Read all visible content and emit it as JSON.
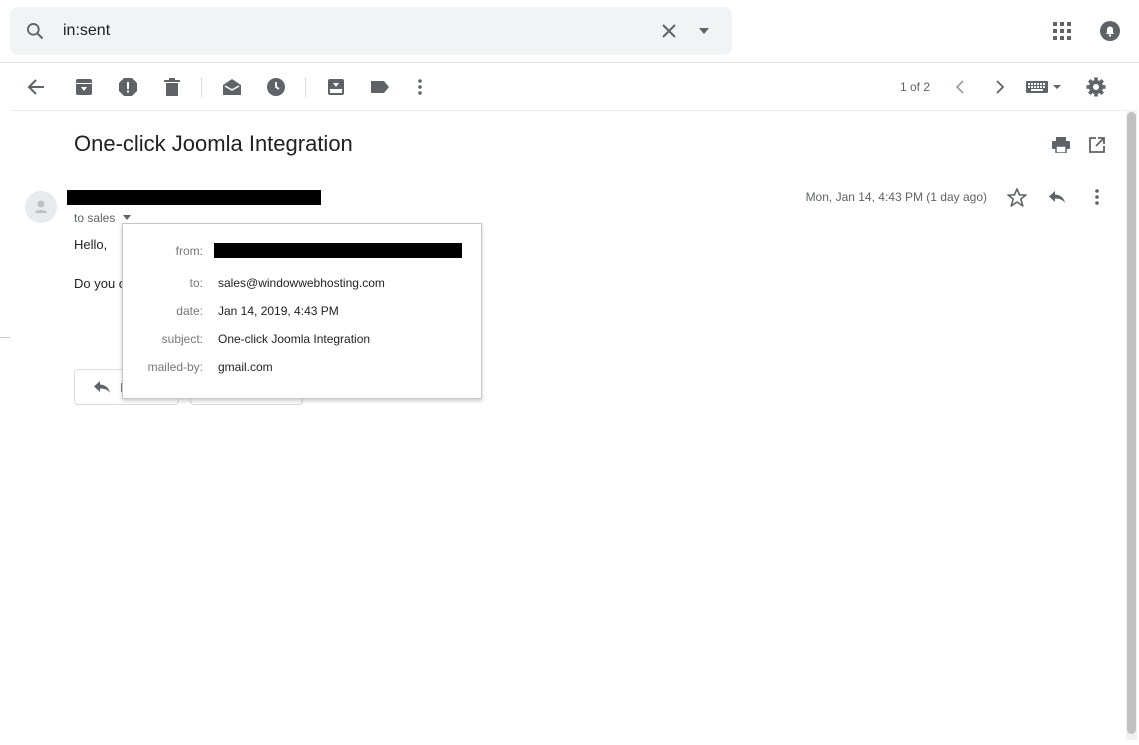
{
  "search": {
    "query": "in:sent"
  },
  "toolbar": {
    "page_count": "1 of 2"
  },
  "message": {
    "subject": "One-click Joomla Integration",
    "to_line": "to sales",
    "date_line": "Mon, Jan 14, 4:43 PM (1 day ago)",
    "greeting": "Hello,",
    "body_partial": "Do you c"
  },
  "details": {
    "from_label": "from:",
    "to_label": "to:",
    "to_value": "sales@windowwebhosting.com",
    "date_label": "date:",
    "date_value": "Jan 14, 2019, 4:43 PM",
    "subject_label": "subject:",
    "subject_value": "One-click Joomla Integration",
    "mailed_by_label": "mailed-by:",
    "mailed_by_value": "gmail.com"
  },
  "reply_button": {
    "partial_label": "I"
  },
  "icons": [
    "search-icon",
    "clear-icon",
    "search-options-icon",
    "apps-icon",
    "notifications-icon",
    "back-icon",
    "archive-icon",
    "report-spam-icon",
    "delete-icon",
    "mark-unread-icon",
    "snooze-icon",
    "move-to-icon",
    "label-icon",
    "more-icon",
    "older-icon",
    "newer-icon",
    "keyboard-icon",
    "settings-icon",
    "print-icon",
    "open-new-window-icon",
    "star-icon",
    "reply-icon",
    "more-message-icon",
    "person-icon",
    "dropdown-icon"
  ]
}
